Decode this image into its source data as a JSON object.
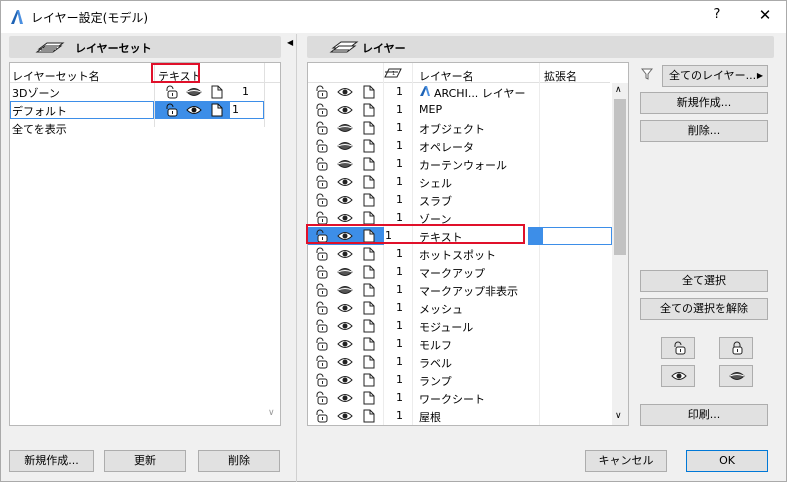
{
  "window": {
    "title": "レイヤー設定(モデル)",
    "help": "?",
    "close": "✕"
  },
  "left_panel": {
    "header": "レイヤーセット",
    "col_name": "レイヤーセット名",
    "col_text": "テキスト",
    "rows": [
      {
        "name": "3Dゾーン",
        "num": "1"
      },
      {
        "name": "デフォルト",
        "num": "1"
      },
      {
        "name": "全てを表示",
        "num": ""
      }
    ],
    "buttons": {
      "new": "新規作成...",
      "update": "更新",
      "delete": "削除"
    }
  },
  "right_panel": {
    "header": "レイヤー",
    "col_name": "レイヤー名",
    "col_ext": "拡張名",
    "filter_label": "全てのレイヤー...",
    "rows": [
      {
        "num": "1",
        "name": "ARCHI... レイヤー",
        "eye": "open",
        "arch_icon": true
      },
      {
        "num": "1",
        "name": "MEP",
        "eye": "open"
      },
      {
        "num": "1",
        "name": "オブジェクト",
        "eye": "closed"
      },
      {
        "num": "1",
        "name": "オペレータ",
        "eye": "closed"
      },
      {
        "num": "1",
        "name": "カーテンウォール",
        "eye": "closed"
      },
      {
        "num": "1",
        "name": "シェル",
        "eye": "open"
      },
      {
        "num": "1",
        "name": "スラブ",
        "eye": "open"
      },
      {
        "num": "1",
        "name": "ゾーン",
        "eye": "open"
      },
      {
        "num": "1",
        "name": "テキスト",
        "eye": "open"
      },
      {
        "num": "1",
        "name": "ホットスポット",
        "eye": "open"
      },
      {
        "num": "1",
        "name": "マークアップ",
        "eye": "closed"
      },
      {
        "num": "1",
        "name": "マークアップ非表示",
        "eye": "closed"
      },
      {
        "num": "1",
        "name": "メッシュ",
        "eye": "open"
      },
      {
        "num": "1",
        "name": "モジュール",
        "eye": "open"
      },
      {
        "num": "1",
        "name": "モルフ",
        "eye": "open"
      },
      {
        "num": "1",
        "name": "ラベル",
        "eye": "open"
      },
      {
        "num": "1",
        "name": "ランプ",
        "eye": "open"
      },
      {
        "num": "1",
        "name": "ワークシート",
        "eye": "open"
      },
      {
        "num": "1",
        "name": "屋根",
        "eye": "open"
      }
    ],
    "buttons": {
      "new": "新規作成...",
      "delete": "削除...",
      "select_all": "全て選択",
      "deselect_all": "全ての選択を解除",
      "print": "印刷...",
      "cancel": "キャンセル",
      "ok": "OK"
    }
  },
  "colors": {
    "selection": "#3d8ee8",
    "red_highlight": "#e0102a",
    "accent": "#0078d7"
  }
}
